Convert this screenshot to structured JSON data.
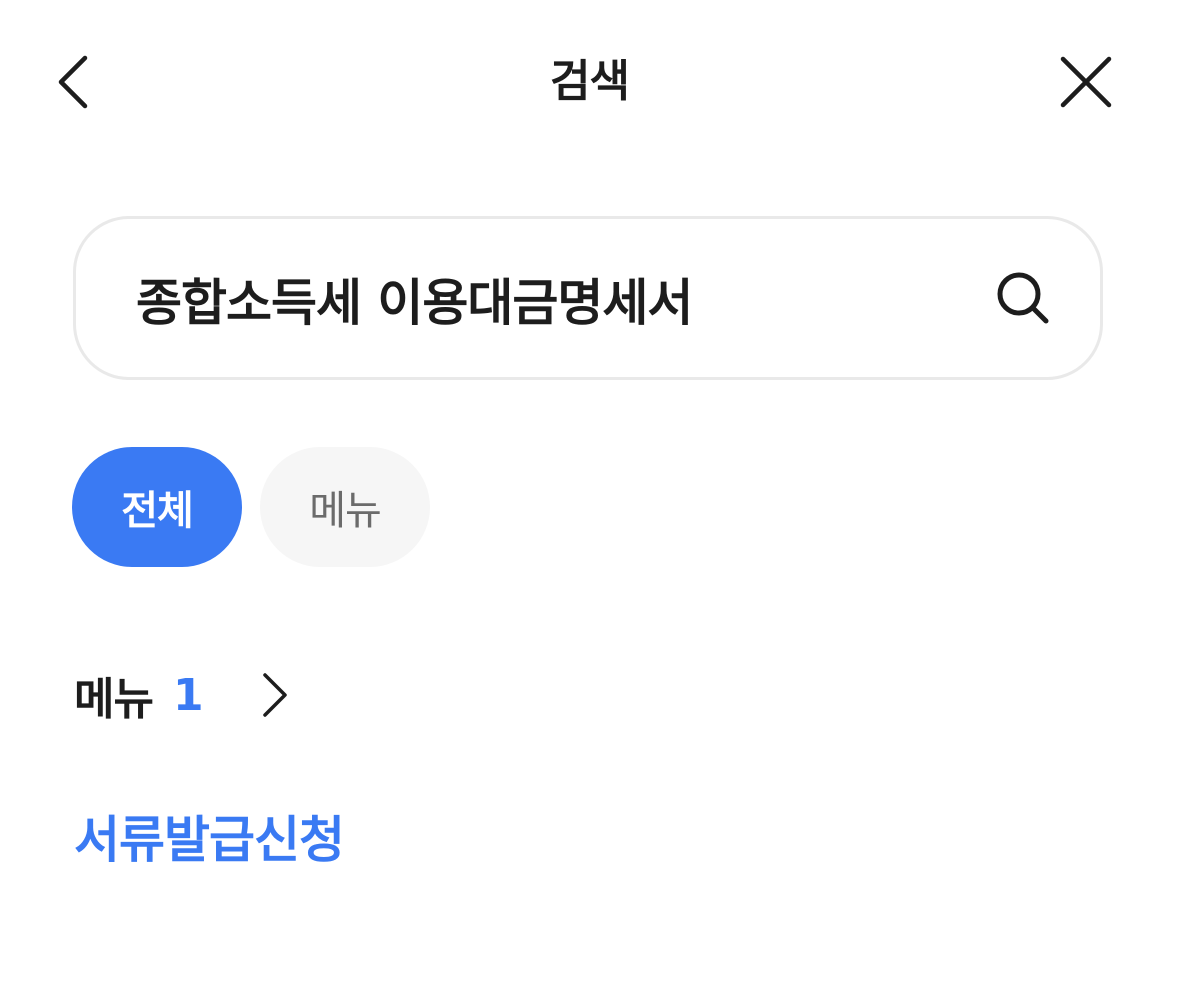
{
  "header": {
    "title": "검색",
    "back_icon": "chevron-left-icon",
    "close_icon": "close-icon"
  },
  "search": {
    "value": "종합소득세 이용대금명세서",
    "icon": "search-icon"
  },
  "filters": {
    "chips": [
      {
        "label": "전체",
        "selected": true
      },
      {
        "label": "메뉴",
        "selected": false
      }
    ]
  },
  "results": {
    "section_label": "메뉴",
    "section_count": "1",
    "section_icon": "chevron-right-icon",
    "items": [
      {
        "label": "서류발급신청"
      }
    ]
  },
  "colors": {
    "accent": "#3a7af3",
    "text": "#1d1d1d",
    "chip_inactive_bg": "#f6f6f6",
    "border": "#e9e9e9"
  }
}
